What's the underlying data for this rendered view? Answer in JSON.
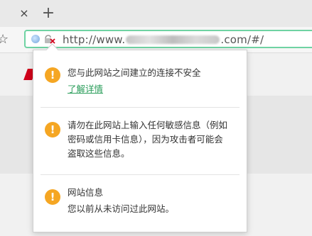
{
  "tab": {
    "close_glyph": "×",
    "new_tab_glyph": "+"
  },
  "toolbar": {
    "url_prefix": "http://www.",
    "url_suffix": ".com/#/"
  },
  "popup": {
    "sections": [
      {
        "icon": "warning-icon",
        "text": "您与此网站之间建立的连接不安全",
        "link": "了解详情"
      },
      {
        "icon": "warning-icon",
        "text": "请勿在此网站上输入任何敏感信息（例如密码或信用卡信息），因为攻击者可能会盗取这些信息。"
      },
      {
        "icon": "warning-icon",
        "title": "网站信息",
        "text": "您以前从未访问过此网站。"
      }
    ]
  },
  "colors": {
    "omnibox_border": "#6fd3a3",
    "warning": "#f5a623",
    "link": "#2a9d5a",
    "insecure_red": "#d0021b"
  }
}
